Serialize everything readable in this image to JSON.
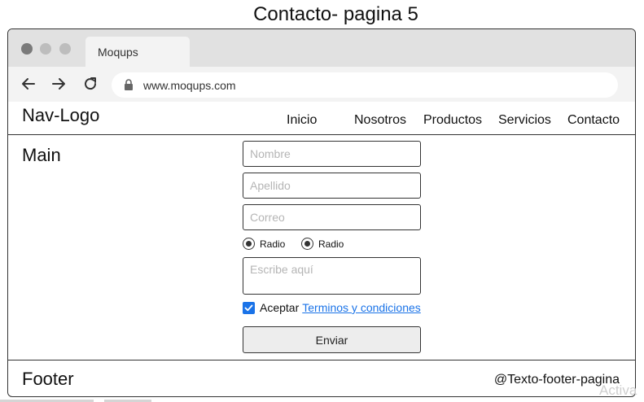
{
  "page_title": "Contacto- pagina 5",
  "browser": {
    "tab_label": "Moqups",
    "url": "www.moqups.com"
  },
  "header": {
    "logo": "Nav-Logo",
    "nav": [
      "Inicio",
      "Nosotros",
      "Productos",
      "Servicios",
      "Contacto"
    ]
  },
  "main": {
    "label": "Main",
    "form": {
      "name_placeholder": "Nombre",
      "lastname_placeholder": "Apellido",
      "email_placeholder": "Correo",
      "radio1_label": "Radio",
      "radio2_label": "Radio",
      "message_placeholder": "Escribe aquí",
      "accept_label": "Aceptar",
      "terms_link": "Terminos y condiciones",
      "submit_label": "Enviar"
    }
  },
  "footer": {
    "label": "Footer",
    "text": "@Texto-footer-pagina"
  },
  "watermark": "Activa",
  "colors": {
    "accent": "#1a73e8",
    "chrome": "#e1e1e1",
    "toolbar": "#f3f3f3"
  }
}
